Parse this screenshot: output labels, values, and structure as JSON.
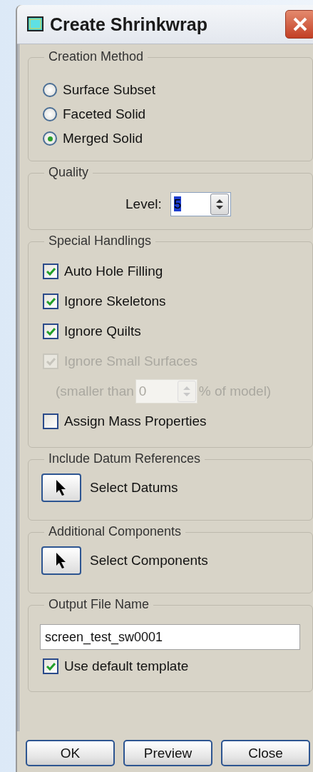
{
  "window": {
    "title": "Create Shrinkwrap"
  },
  "creation_method": {
    "title": "Creation Method",
    "options": [
      {
        "label": "Surface Subset",
        "selected": false
      },
      {
        "label": "Faceted Solid",
        "selected": false
      },
      {
        "label": "Merged Solid",
        "selected": true
      }
    ]
  },
  "quality": {
    "title": "Quality",
    "label": "Level:",
    "value": "5",
    "value_highlighted": true
  },
  "special_handlings": {
    "title": "Special Handlings",
    "items": [
      {
        "kind": "checkbox",
        "label": "Auto Hole Filling",
        "checked": true,
        "disabled": false
      },
      {
        "kind": "checkbox",
        "label": "Ignore Skeletons",
        "checked": true,
        "disabled": false
      },
      {
        "kind": "checkbox",
        "label": "Ignore Quilts",
        "checked": true,
        "disabled": false
      },
      {
        "kind": "checkbox",
        "label": "Ignore Small Surfaces",
        "checked": true,
        "disabled": true
      },
      {
        "kind": "threshold",
        "prefix": "(smaller than",
        "value": "0",
        "suffix": "% of model)",
        "disabled": true
      },
      {
        "kind": "checkbox",
        "label": "Assign Mass Properties",
        "checked": false,
        "disabled": false
      }
    ]
  },
  "datum_references": {
    "title": "Include Datum References",
    "button": "Select Datums"
  },
  "additional_components": {
    "title": "Additional Components",
    "button": "Select Components"
  },
  "output_file": {
    "title": "Output File Name",
    "value": "screen_test_sw0001",
    "checkbox": {
      "label": "Use default template",
      "checked": true
    }
  },
  "buttons": [
    "OK",
    "Preview",
    "Close"
  ]
}
